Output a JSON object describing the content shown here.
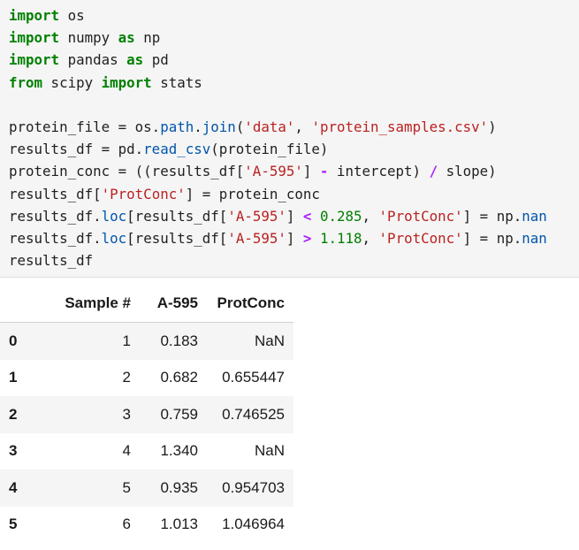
{
  "code_cell": {
    "lines": [
      "import os",
      "import numpy as np",
      "import pandas as pd",
      "from scipy import stats",
      "",
      "protein_file = os.path.join('data', 'protein_samples.csv')",
      "results_df = pd.read_csv(protein_file)",
      "protein_conc = ((results_df['A-595'] - intercept) / slope)",
      "results_df['ProtConc'] = protein_conc",
      "results_df.loc[results_df['A-595'] < 0.285, 'ProtConc'] = np.nan",
      "results_df.loc[results_df['A-595'] > 1.118, 'ProtConc'] = np.nan",
      "results_df"
    ]
  },
  "output_table": {
    "columns": [
      "",
      "Sample #",
      "A-595",
      "ProtConc"
    ],
    "rows": [
      {
        "index": "0",
        "sample": "1",
        "a595": "0.183",
        "protconc": "NaN"
      },
      {
        "index": "1",
        "sample": "2",
        "a595": "0.682",
        "protconc": "0.655447"
      },
      {
        "index": "2",
        "sample": "3",
        "a595": "0.759",
        "protconc": "0.746525"
      },
      {
        "index": "3",
        "sample": "4",
        "a595": "1.340",
        "protconc": "NaN"
      },
      {
        "index": "4",
        "sample": "5",
        "a595": "0.935",
        "protconc": "0.954703"
      },
      {
        "index": "5",
        "sample": "6",
        "a595": "1.013",
        "protconc": "1.046964"
      }
    ]
  }
}
